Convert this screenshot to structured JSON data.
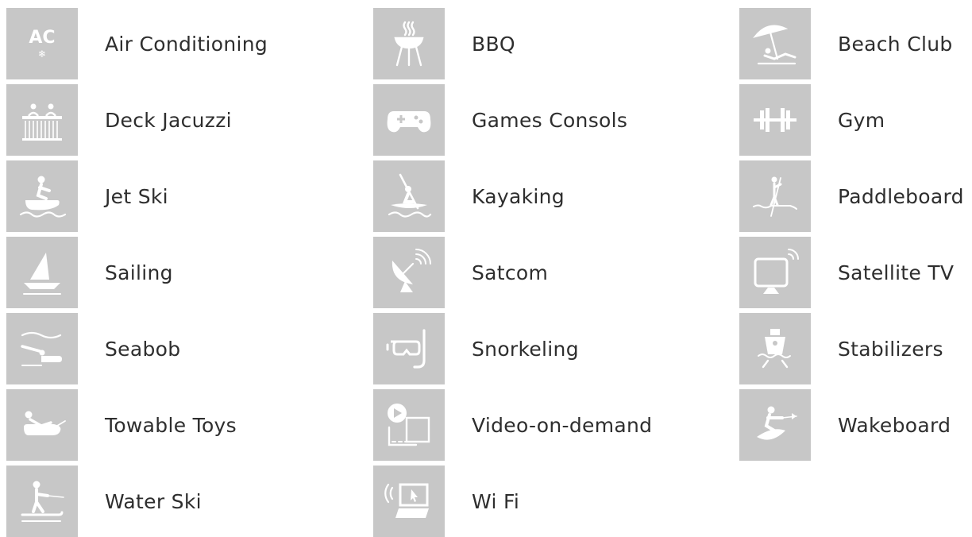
{
  "amenities": [
    {
      "label": "Air Conditioning",
      "icon": "air-conditioning-icon",
      "icon_text": "AC"
    },
    {
      "label": "BBQ",
      "icon": "bbq-grill-icon"
    },
    {
      "label": "Beach Club",
      "icon": "beach-club-icon"
    },
    {
      "label": "Deck Jacuzzi",
      "icon": "deck-jacuzzi-icon"
    },
    {
      "label": "Games Consols",
      "icon": "game-controller-icon"
    },
    {
      "label": "Gym",
      "icon": "dumbbell-icon"
    },
    {
      "label": "Jet Ski",
      "icon": "jet-ski-icon"
    },
    {
      "label": "Kayaking",
      "icon": "kayak-icon"
    },
    {
      "label": "Paddleboard",
      "icon": "paddleboard-icon"
    },
    {
      "label": "Sailing",
      "icon": "sailboat-icon"
    },
    {
      "label": "Satcom",
      "icon": "satellite-dish-icon"
    },
    {
      "label": "Satellite TV",
      "icon": "satellite-tv-icon"
    },
    {
      "label": "Seabob",
      "icon": "seabob-icon"
    },
    {
      "label": "Snorkeling",
      "icon": "snorkel-mask-icon"
    },
    {
      "label": "Stabilizers",
      "icon": "stabilizers-icon"
    },
    {
      "label": "Towable Toys",
      "icon": "towable-toys-icon"
    },
    {
      "label": "Video-on-demand",
      "icon": "video-on-demand-icon"
    },
    {
      "label": "Wakeboard",
      "icon": "wakeboard-icon"
    },
    {
      "label": "Water Ski",
      "icon": "water-ski-icon"
    },
    {
      "label": "Wi Fi",
      "icon": "wifi-laptop-icon"
    }
  ],
  "colors": {
    "tile": "#c7c7c7",
    "icon": "#ffffff",
    "text": "#2e2e2e"
  }
}
